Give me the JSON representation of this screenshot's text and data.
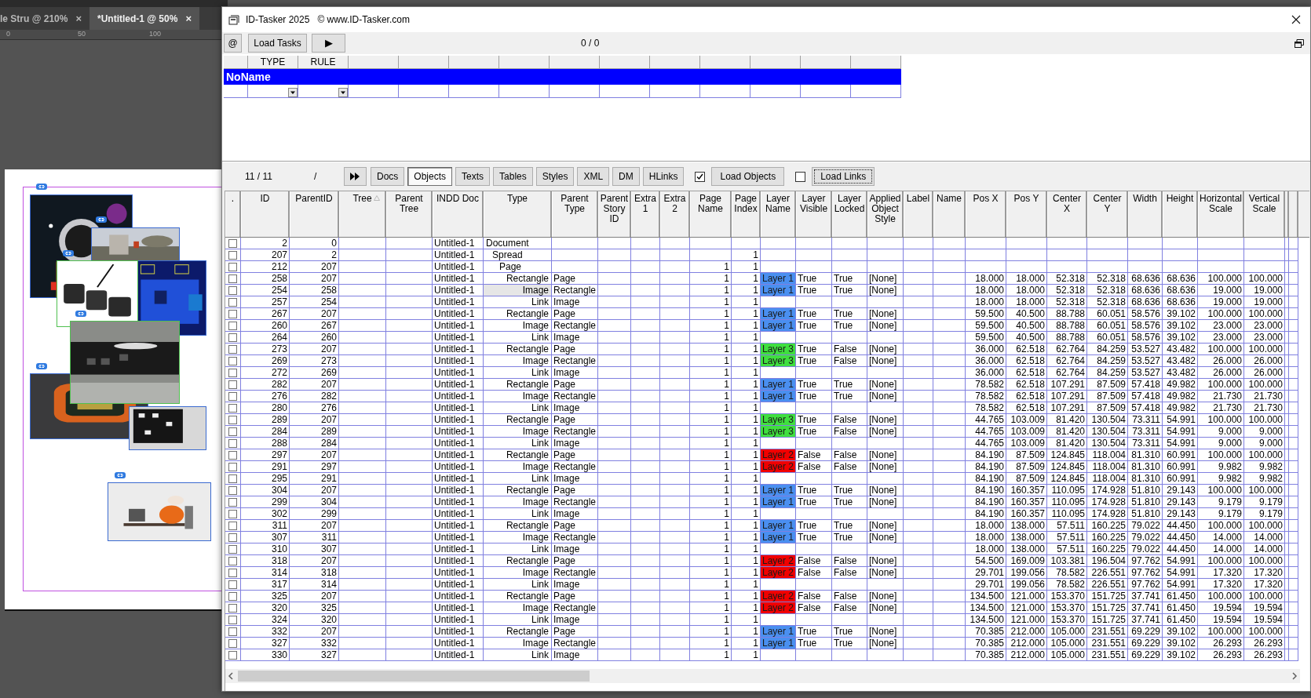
{
  "indesign": {
    "tabs": [
      {
        "label": "le Stru @ 210%",
        "close": "×",
        "selected": false
      },
      {
        "label": "*Untitled-1 @ 50%",
        "close": "×",
        "selected": true
      }
    ],
    "ruler": [
      "0",
      "50",
      "100"
    ]
  },
  "window": {
    "title": "ID-Tasker 2025",
    "copyright": "© www.ID-Tasker.com"
  },
  "toolbar": {
    "at_button": "@",
    "load_button": "Load Tasks",
    "run_button": "▶",
    "counter": "0 / 0"
  },
  "tasks_grid": {
    "columns": [
      "TYPE",
      "RULE"
    ],
    "group": "NoName"
  },
  "objects_toolbar": {
    "counter": "11 / 11",
    "separator": "/",
    "tabs": [
      {
        "label": "Docs",
        "selected": false
      },
      {
        "label": "Objects",
        "selected": true
      },
      {
        "label": "Texts",
        "selected": false
      },
      {
        "label": "Tables",
        "selected": false
      },
      {
        "label": "Styles",
        "selected": false
      },
      {
        "label": "XML",
        "selected": false
      },
      {
        "label": "DM",
        "selected": false
      },
      {
        "label": "HLinks",
        "selected": false
      }
    ],
    "loaders": [
      {
        "label": "Load Objects",
        "checked": true,
        "focused": false
      },
      {
        "label": "Load Links",
        "checked": false,
        "focused": true
      }
    ]
  },
  "table": {
    "columns": [
      ".",
      "ID",
      "ParentID",
      "Tree",
      "Parent Tree",
      "INDD Doc",
      "Type",
      "Parent Type",
      "Parent Story ID",
      "Extra 1",
      "Extra 2",
      "Page Name",
      "Page Index",
      "Layer Name",
      "Layer Visible",
      "Layer Locked",
      "Applied Object Style",
      "Label",
      "Name",
      "Pos X",
      "Pos Y",
      "Center X",
      "Center Y",
      "Width",
      "Height",
      "Horizontal Scale",
      "Vertical Scale"
    ],
    "rows": [
      {
        "id": "2",
        "parent_id": "0",
        "doc": "Untitled-1",
        "type": "Document",
        "kind": "document",
        "checked": false,
        "current": false
      },
      {
        "id": "207",
        "parent_id": "2",
        "doc": "Untitled-1",
        "type": "Spread",
        "kind": "spread",
        "page_index": "1",
        "checked": false,
        "current": false
      },
      {
        "id": "212",
        "parent_id": "207",
        "doc": "Untitled-1",
        "type": "Page",
        "kind": "page",
        "page_name": "1",
        "page_index": "1",
        "checked": false,
        "current": false
      },
      {
        "id": "258",
        "parent_id": "207",
        "doc": "Untitled-1",
        "type": "Rectangle",
        "kind": "object",
        "parent_type": "Page",
        "page_name": "1",
        "page_index": "1",
        "layer": {
          "name": "Layer 1",
          "color": "#4a8ff0"
        },
        "visible": "True",
        "locked": "True",
        "style": "[None]",
        "geometry": [
          "18.000",
          "18.000",
          "52.318",
          "52.318",
          "68.636",
          "68.636",
          "100.000",
          "100.000"
        ],
        "checked": false,
        "current": false
      },
      {
        "id": "254",
        "parent_id": "258",
        "doc": "Untitled-1",
        "type": "Image",
        "kind": "object",
        "parent_type": "Rectangle",
        "page_name": "1",
        "page_index": "1",
        "layer": {
          "name": "Layer 1",
          "color": "#4a8ff0"
        },
        "visible": "True",
        "locked": "True",
        "style": "[None]",
        "geometry": [
          "18.000",
          "18.000",
          "52.318",
          "52.318",
          "68.636",
          "68.636",
          "19.000",
          "19.000"
        ],
        "checked": false,
        "current": true
      },
      {
        "id": "257",
        "parent_id": "254",
        "doc": "Untitled-1",
        "type": "Link",
        "kind": "object",
        "parent_type": "Image",
        "page_name": "1",
        "page_index": "1",
        "geometry": [
          "18.000",
          "18.000",
          "52.318",
          "52.318",
          "68.636",
          "68.636",
          "19.000",
          "19.000"
        ],
        "checked": false,
        "current": false
      },
      {
        "id": "267",
        "parent_id": "207",
        "doc": "Untitled-1",
        "type": "Rectangle",
        "kind": "object",
        "parent_type": "Page",
        "page_name": "1",
        "page_index": "1",
        "layer": {
          "name": "Layer 1",
          "color": "#4a8ff0"
        },
        "visible": "True",
        "locked": "True",
        "style": "[None]",
        "geometry": [
          "59.500",
          "40.500",
          "88.788",
          "60.051",
          "58.576",
          "39.102",
          "100.000",
          "100.000"
        ],
        "checked": false,
        "current": false
      },
      {
        "id": "260",
        "parent_id": "267",
        "doc": "Untitled-1",
        "type": "Image",
        "kind": "object",
        "parent_type": "Rectangle",
        "page_name": "1",
        "page_index": "1",
        "layer": {
          "name": "Layer 1",
          "color": "#4a8ff0"
        },
        "visible": "True",
        "locked": "True",
        "style": "[None]",
        "geometry": [
          "59.500",
          "40.500",
          "88.788",
          "60.051",
          "58.576",
          "39.102",
          "23.000",
          "23.000"
        ],
        "checked": false,
        "current": false
      },
      {
        "id": "264",
        "parent_id": "260",
        "doc": "Untitled-1",
        "type": "Link",
        "kind": "object",
        "parent_type": "Image",
        "page_name": "1",
        "page_index": "1",
        "geometry": [
          "59.500",
          "40.500",
          "88.788",
          "60.051",
          "58.576",
          "39.102",
          "23.000",
          "23.000"
        ],
        "checked": false,
        "current": false
      },
      {
        "id": "273",
        "parent_id": "207",
        "doc": "Untitled-1",
        "type": "Rectangle",
        "kind": "object",
        "parent_type": "Page",
        "page_name": "1",
        "page_index": "1",
        "layer": {
          "name": "Layer 3",
          "color": "#3fdf3f"
        },
        "visible": "True",
        "locked": "False",
        "style": "[None]",
        "geometry": [
          "36.000",
          "62.518",
          "62.764",
          "84.259",
          "53.527",
          "43.482",
          "100.000",
          "100.000"
        ],
        "checked": false,
        "current": false
      },
      {
        "id": "269",
        "parent_id": "273",
        "doc": "Untitled-1",
        "type": "Image",
        "kind": "object",
        "parent_type": "Rectangle",
        "page_name": "1",
        "page_index": "1",
        "layer": {
          "name": "Layer 3",
          "color": "#3fdf3f"
        },
        "visible": "True",
        "locked": "False",
        "style": "[None]",
        "geometry": [
          "36.000",
          "62.518",
          "62.764",
          "84.259",
          "53.527",
          "43.482",
          "26.000",
          "26.000"
        ],
        "checked": false,
        "current": false
      },
      {
        "id": "272",
        "parent_id": "269",
        "doc": "Untitled-1",
        "type": "Link",
        "kind": "object",
        "parent_type": "Image",
        "page_name": "1",
        "page_index": "1",
        "geometry": [
          "36.000",
          "62.518",
          "62.764",
          "84.259",
          "53.527",
          "43.482",
          "26.000",
          "26.000"
        ],
        "checked": false,
        "current": false
      },
      {
        "id": "282",
        "parent_id": "207",
        "doc": "Untitled-1",
        "type": "Rectangle",
        "kind": "object",
        "parent_type": "Page",
        "page_name": "1",
        "page_index": "1",
        "layer": {
          "name": "Layer 1",
          "color": "#4a8ff0"
        },
        "visible": "True",
        "locked": "True",
        "style": "[None]",
        "geometry": [
          "78.582",
          "62.518",
          "107.291",
          "87.509",
          "57.418",
          "49.982",
          "100.000",
          "100.000"
        ],
        "checked": false,
        "current": false
      },
      {
        "id": "276",
        "parent_id": "282",
        "doc": "Untitled-1",
        "type": "Image",
        "kind": "object",
        "parent_type": "Rectangle",
        "page_name": "1",
        "page_index": "1",
        "layer": {
          "name": "Layer 1",
          "color": "#4a8ff0"
        },
        "visible": "True",
        "locked": "True",
        "style": "[None]",
        "geometry": [
          "78.582",
          "62.518",
          "107.291",
          "87.509",
          "57.418",
          "49.982",
          "21.730",
          "21.730"
        ],
        "checked": false,
        "current": false
      },
      {
        "id": "280",
        "parent_id": "276",
        "doc": "Untitled-1",
        "type": "Link",
        "kind": "object",
        "parent_type": "Image",
        "page_name": "1",
        "page_index": "1",
        "geometry": [
          "78.582",
          "62.518",
          "107.291",
          "87.509",
          "57.418",
          "49.982",
          "21.730",
          "21.730"
        ],
        "checked": false,
        "current": false
      },
      {
        "id": "289",
        "parent_id": "207",
        "doc": "Untitled-1",
        "type": "Rectangle",
        "kind": "object",
        "parent_type": "Page",
        "page_name": "1",
        "page_index": "1",
        "layer": {
          "name": "Layer 3",
          "color": "#3fdf3f"
        },
        "visible": "True",
        "locked": "False",
        "style": "[None]",
        "geometry": [
          "44.765",
          "103.009",
          "81.420",
          "130.504",
          "73.311",
          "54.991",
          "100.000",
          "100.000"
        ],
        "checked": false,
        "current": false
      },
      {
        "id": "284",
        "parent_id": "289",
        "doc": "Untitled-1",
        "type": "Image",
        "kind": "object",
        "parent_type": "Rectangle",
        "page_name": "1",
        "page_index": "1",
        "layer": {
          "name": "Layer 3",
          "color": "#3fdf3f"
        },
        "visible": "True",
        "locked": "False",
        "style": "[None]",
        "geometry": [
          "44.765",
          "103.009",
          "81.420",
          "130.504",
          "73.311",
          "54.991",
          "9.000",
          "9.000"
        ],
        "checked": false,
        "current": false
      },
      {
        "id": "288",
        "parent_id": "284",
        "doc": "Untitled-1",
        "type": "Link",
        "kind": "object",
        "parent_type": "Image",
        "page_name": "1",
        "page_index": "1",
        "geometry": [
          "44.765",
          "103.009",
          "81.420",
          "130.504",
          "73.311",
          "54.991",
          "9.000",
          "9.000"
        ],
        "checked": false,
        "current": false
      },
      {
        "id": "297",
        "parent_id": "207",
        "doc": "Untitled-1",
        "type": "Rectangle",
        "kind": "object",
        "parent_type": "Page",
        "page_name": "1",
        "page_index": "1",
        "layer": {
          "name": "Layer 2",
          "color": "#f00000"
        },
        "visible": "False",
        "locked": "False",
        "style": "[None]",
        "geometry": [
          "84.190",
          "87.509",
          "124.845",
          "118.004",
          "81.310",
          "60.991",
          "100.000",
          "100.000"
        ],
        "checked": false,
        "current": false
      },
      {
        "id": "291",
        "parent_id": "297",
        "doc": "Untitled-1",
        "type": "Image",
        "kind": "object",
        "parent_type": "Rectangle",
        "page_name": "1",
        "page_index": "1",
        "layer": {
          "name": "Layer 2",
          "color": "#f00000"
        },
        "visible": "False",
        "locked": "False",
        "style": "[None]",
        "geometry": [
          "84.190",
          "87.509",
          "124.845",
          "118.004",
          "81.310",
          "60.991",
          "9.982",
          "9.982"
        ],
        "checked": false,
        "current": false
      },
      {
        "id": "295",
        "parent_id": "291",
        "doc": "Untitled-1",
        "type": "Link",
        "kind": "object",
        "parent_type": "Image",
        "page_name": "1",
        "page_index": "1",
        "geometry": [
          "84.190",
          "87.509",
          "124.845",
          "118.004",
          "81.310",
          "60.991",
          "9.982",
          "9.982"
        ],
        "checked": false,
        "current": false
      },
      {
        "id": "304",
        "parent_id": "207",
        "doc": "Untitled-1",
        "type": "Rectangle",
        "kind": "object",
        "parent_type": "Page",
        "page_name": "1",
        "page_index": "1",
        "layer": {
          "name": "Layer 1",
          "color": "#4a8ff0"
        },
        "visible": "True",
        "locked": "True",
        "style": "[None]",
        "geometry": [
          "84.190",
          "160.357",
          "110.095",
          "174.928",
          "51.810",
          "29.143",
          "100.000",
          "100.000"
        ],
        "checked": false,
        "current": false
      },
      {
        "id": "299",
        "parent_id": "304",
        "doc": "Untitled-1",
        "type": "Image",
        "kind": "object",
        "parent_type": "Rectangle",
        "page_name": "1",
        "page_index": "1",
        "layer": {
          "name": "Layer 1",
          "color": "#4a8ff0"
        },
        "visible": "True",
        "locked": "True",
        "style": "[None]",
        "geometry": [
          "84.190",
          "160.357",
          "110.095",
          "174.928",
          "51.810",
          "29.143",
          "9.179",
          "9.179"
        ],
        "checked": false,
        "current": false
      },
      {
        "id": "302",
        "parent_id": "299",
        "doc": "Untitled-1",
        "type": "Link",
        "kind": "object",
        "parent_type": "Image",
        "page_name": "1",
        "page_index": "1",
        "geometry": [
          "84.190",
          "160.357",
          "110.095",
          "174.928",
          "51.810",
          "29.143",
          "9.179",
          "9.179"
        ],
        "checked": false,
        "current": false
      },
      {
        "id": "311",
        "parent_id": "207",
        "doc": "Untitled-1",
        "type": "Rectangle",
        "kind": "object",
        "parent_type": "Page",
        "page_name": "1",
        "page_index": "1",
        "layer": {
          "name": "Layer 1",
          "color": "#4a8ff0"
        },
        "visible": "True",
        "locked": "True",
        "style": "[None]",
        "geometry": [
          "18.000",
          "138.000",
          "57.511",
          "160.225",
          "79.022",
          "44.450",
          "100.000",
          "100.000"
        ],
        "checked": false,
        "current": false
      },
      {
        "id": "307",
        "parent_id": "311",
        "doc": "Untitled-1",
        "type": "Image",
        "kind": "object",
        "parent_type": "Rectangle",
        "page_name": "1",
        "page_index": "1",
        "layer": {
          "name": "Layer 1",
          "color": "#4a8ff0"
        },
        "visible": "True",
        "locked": "True",
        "style": "[None]",
        "geometry": [
          "18.000",
          "138.000",
          "57.511",
          "160.225",
          "79.022",
          "44.450",
          "14.000",
          "14.000"
        ],
        "checked": false,
        "current": false
      },
      {
        "id": "310",
        "parent_id": "307",
        "doc": "Untitled-1",
        "type": "Link",
        "kind": "object",
        "parent_type": "Image",
        "page_name": "1",
        "page_index": "1",
        "geometry": [
          "18.000",
          "138.000",
          "57.511",
          "160.225",
          "79.022",
          "44.450",
          "14.000",
          "14.000"
        ],
        "checked": false,
        "current": false
      },
      {
        "id": "318",
        "parent_id": "207",
        "doc": "Untitled-1",
        "type": "Rectangle",
        "kind": "object",
        "parent_type": "Page",
        "page_name": "1",
        "page_index": "1",
        "layer": {
          "name": "Layer 2",
          "color": "#f00000"
        },
        "visible": "False",
        "locked": "False",
        "style": "[None]",
        "geometry": [
          "54.500",
          "169.009",
          "103.381",
          "196.504",
          "97.762",
          "54.991",
          "100.000",
          "100.000"
        ],
        "checked": false,
        "current": false
      },
      {
        "id": "314",
        "parent_id": "318",
        "doc": "Untitled-1",
        "type": "Image",
        "kind": "object",
        "parent_type": "Rectangle",
        "page_name": "1",
        "page_index": "1",
        "layer": {
          "name": "Layer 2",
          "color": "#f00000"
        },
        "visible": "False",
        "locked": "False",
        "style": "[None]",
        "geometry": [
          "29.701",
          "199.056",
          "78.582",
          "226.551",
          "97.762",
          "54.991",
          "17.320",
          "17.320"
        ],
        "checked": false,
        "current": false
      },
      {
        "id": "317",
        "parent_id": "314",
        "doc": "Untitled-1",
        "type": "Link",
        "kind": "object",
        "parent_type": "Image",
        "page_name": "1",
        "page_index": "1",
        "geometry": [
          "29.701",
          "199.056",
          "78.582",
          "226.551",
          "97.762",
          "54.991",
          "17.320",
          "17.320"
        ],
        "checked": false,
        "current": false
      },
      {
        "id": "325",
        "parent_id": "207",
        "doc": "Untitled-1",
        "type": "Rectangle",
        "kind": "object",
        "parent_type": "Page",
        "page_name": "1",
        "page_index": "1",
        "layer": {
          "name": "Layer 2",
          "color": "#f00000"
        },
        "visible": "False",
        "locked": "False",
        "style": "[None]",
        "geometry": [
          "134.500",
          "121.000",
          "153.370",
          "151.725",
          "37.741",
          "61.450",
          "100.000",
          "100.000"
        ],
        "checked": false,
        "current": false
      },
      {
        "id": "320",
        "parent_id": "325",
        "doc": "Untitled-1",
        "type": "Image",
        "kind": "object",
        "parent_type": "Rectangle",
        "page_name": "1",
        "page_index": "1",
        "layer": {
          "name": "Layer 2",
          "color": "#f00000"
        },
        "visible": "False",
        "locked": "False",
        "style": "[None]",
        "geometry": [
          "134.500",
          "121.000",
          "153.370",
          "151.725",
          "37.741",
          "61.450",
          "19.594",
          "19.594"
        ],
        "checked": false,
        "current": false
      },
      {
        "id": "324",
        "parent_id": "320",
        "doc": "Untitled-1",
        "type": "Link",
        "kind": "object",
        "parent_type": "Image",
        "page_name": "1",
        "page_index": "1",
        "geometry": [
          "134.500",
          "121.000",
          "153.370",
          "151.725",
          "37.741",
          "61.450",
          "19.594",
          "19.594"
        ],
        "checked": false,
        "current": false
      },
      {
        "id": "332",
        "parent_id": "207",
        "doc": "Untitled-1",
        "type": "Rectangle",
        "kind": "object",
        "parent_type": "Page",
        "page_name": "1",
        "page_index": "1",
        "layer": {
          "name": "Layer 1",
          "color": "#4a8ff0"
        },
        "visible": "True",
        "locked": "True",
        "style": "[None]",
        "geometry": [
          "70.385",
          "212.000",
          "105.000",
          "231.551",
          "69.229",
          "39.102",
          "100.000",
          "100.000"
        ],
        "checked": false,
        "current": false
      },
      {
        "id": "327",
        "parent_id": "332",
        "doc": "Untitled-1",
        "type": "Image",
        "kind": "object",
        "parent_type": "Rectangle",
        "page_name": "1",
        "page_index": "1",
        "layer": {
          "name": "Layer 1",
          "color": "#4a8ff0"
        },
        "visible": "True",
        "locked": "True",
        "style": "[None]",
        "geometry": [
          "70.385",
          "212.000",
          "105.000",
          "231.551",
          "69.229",
          "39.102",
          "26.293",
          "26.293"
        ],
        "checked": false,
        "current": false
      },
      {
        "id": "330",
        "parent_id": "327",
        "doc": "Untitled-1",
        "type": "Link",
        "kind": "object",
        "parent_type": "Image",
        "page_name": "1",
        "page_index": "1",
        "geometry": [
          "70.385",
          "212.000",
          "105.000",
          "231.551",
          "69.229",
          "39.102",
          "26.293",
          "26.293"
        ],
        "checked": false,
        "current": false
      }
    ]
  }
}
